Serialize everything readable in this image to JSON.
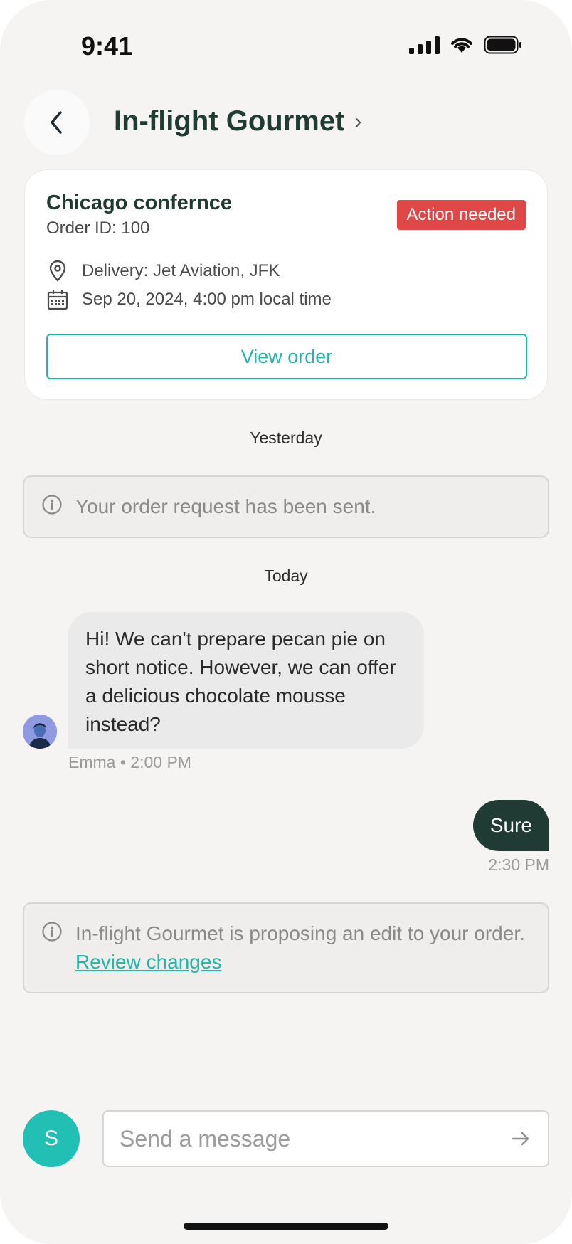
{
  "status_bar": {
    "time": "9:41"
  },
  "header": {
    "title": "In-flight Gourmet",
    "title_chevron": "›"
  },
  "order_card": {
    "title": "Chicago confernce",
    "order_id": "Order ID: 100",
    "badge": "Action needed",
    "delivery": "Delivery: Jet Aviation, JFK",
    "datetime": "Sep 20, 2024, 4:00 pm local time",
    "view_button": "View order"
  },
  "thread": {
    "yesterday_label": "Yesterday",
    "notice_sent": "Your order request has been sent.",
    "today_label": "Today",
    "incoming": {
      "text": "Hi! We can't prepare pecan pie on short notice. However, we can offer a delicious chocolate mousse instead?",
      "meta": "Emma • 2:00 PM"
    },
    "outgoing": {
      "text": "Sure",
      "meta": "2:30 PM"
    },
    "notice_edit": {
      "text": "In-flight Gourmet is proposing an edit to your order. ",
      "link": "Review changes"
    }
  },
  "composer": {
    "user_initial": "S",
    "placeholder": "Send a message"
  },
  "colors": {
    "accent": "#22b5a8",
    "dark_green": "#1f3b33",
    "badge_red": "#e04848",
    "background": "#f6f4f2"
  },
  "icons": {
    "back": "chevron-left-icon",
    "location": "map-pin-icon",
    "calendar": "calendar-icon",
    "info": "info-icon",
    "send": "arrow-right-icon"
  }
}
